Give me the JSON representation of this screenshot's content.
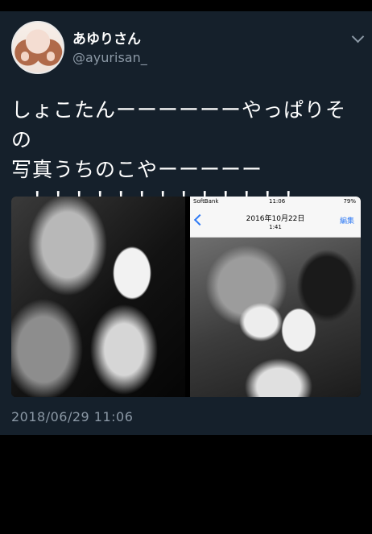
{
  "tweet": {
    "display_name": "あゆりさん",
    "handle": "@ayurisan_",
    "text": "しょこたんーーーーーーやっぱりその\n写真うちのこやーーーーー\nー！！！！！！！！！！！！！",
    "timestamp": "2018/06/29 11:06"
  },
  "screenshot_inset": {
    "carrier": "SoftBank",
    "time": "11:06",
    "battery": "79%",
    "date": "2016年10月22日",
    "photo_time": "1:41",
    "edit_label": "編集"
  },
  "colors": {
    "background": "#15202b",
    "secondary_text": "#8b98a5",
    "ios_accent": "#2f7af5"
  }
}
